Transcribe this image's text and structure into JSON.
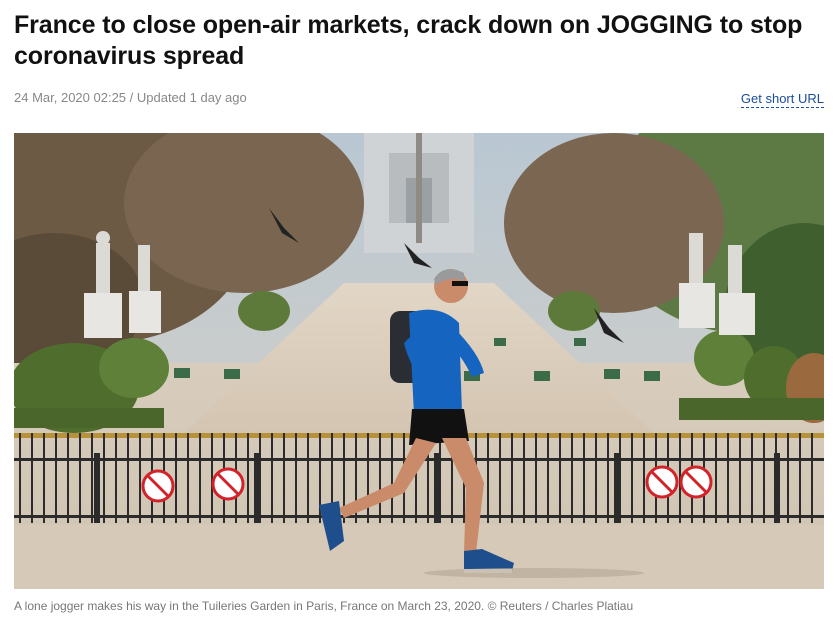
{
  "article": {
    "headline": "France to close open-air markets, crack down on JOGGING to stop coronavirus spread",
    "dateline": "24 Mar, 2020 02:25 / Updated 1 day ago",
    "short_url_label": "Get short URL",
    "photo_caption": "A lone jogger makes his way in the Tuileries Garden in Paris, France on March 23, 2020. © Reuters / Charles Platiau"
  },
  "colors": {
    "link": "#1a4d9c",
    "meta_text": "#888888",
    "headline": "#111111"
  }
}
